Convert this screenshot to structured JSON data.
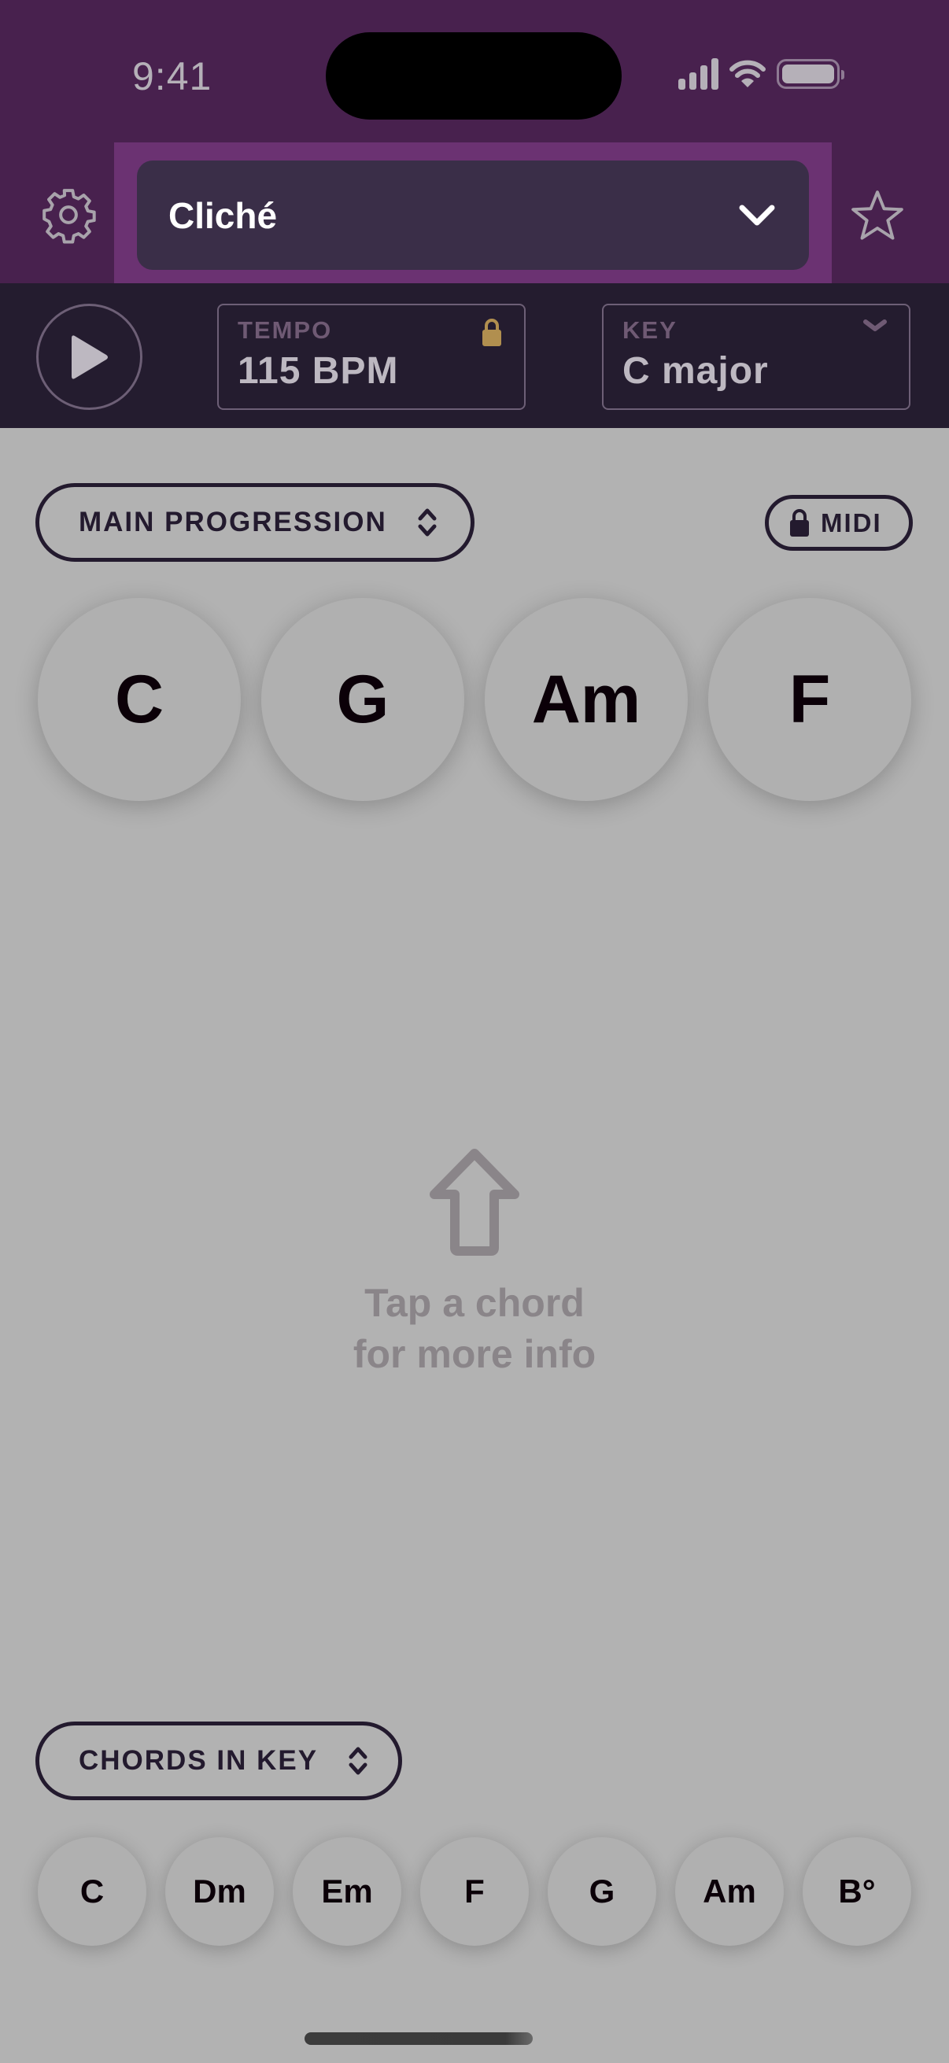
{
  "status_bar": {
    "time": "9:41",
    "icons": [
      "cellular-signal-icon",
      "wifi-icon",
      "battery-icon"
    ]
  },
  "header": {
    "settings_icon": "gear-icon",
    "song_selector": {
      "title": "Cliché",
      "icon": "chevron-down-icon"
    },
    "favorite_icon": "star-icon"
  },
  "transport": {
    "play_icon": "play-icon",
    "tempo": {
      "label": "TEMPO",
      "value": "115 BPM",
      "icon": "lock-icon",
      "icon_color": "#b18f4f"
    },
    "key": {
      "label": "KEY",
      "value": "C major",
      "icon": "chevron-down-icon"
    }
  },
  "progression": {
    "selector_label": "MAIN PROGRESSION",
    "midi_label": "MIDI",
    "chords": [
      "C",
      "G",
      "Am",
      "F"
    ]
  },
  "hint": {
    "icon": "arrow-up-icon",
    "line1": "Tap a chord",
    "line2": "for more info"
  },
  "chords_in_key": {
    "selector_label": "CHORDS IN KEY",
    "chords": [
      "C",
      "Dm",
      "Em",
      "F",
      "G",
      "Am",
      "B°"
    ]
  },
  "colors": {
    "header_bg": "#48214e",
    "selector_highlight": "#6b3272",
    "selector_bg": "#3a2e48",
    "transport_bg": "#241c2f",
    "content_bg": "#b2b2b2",
    "accent_lock": "#b18f4f"
  }
}
